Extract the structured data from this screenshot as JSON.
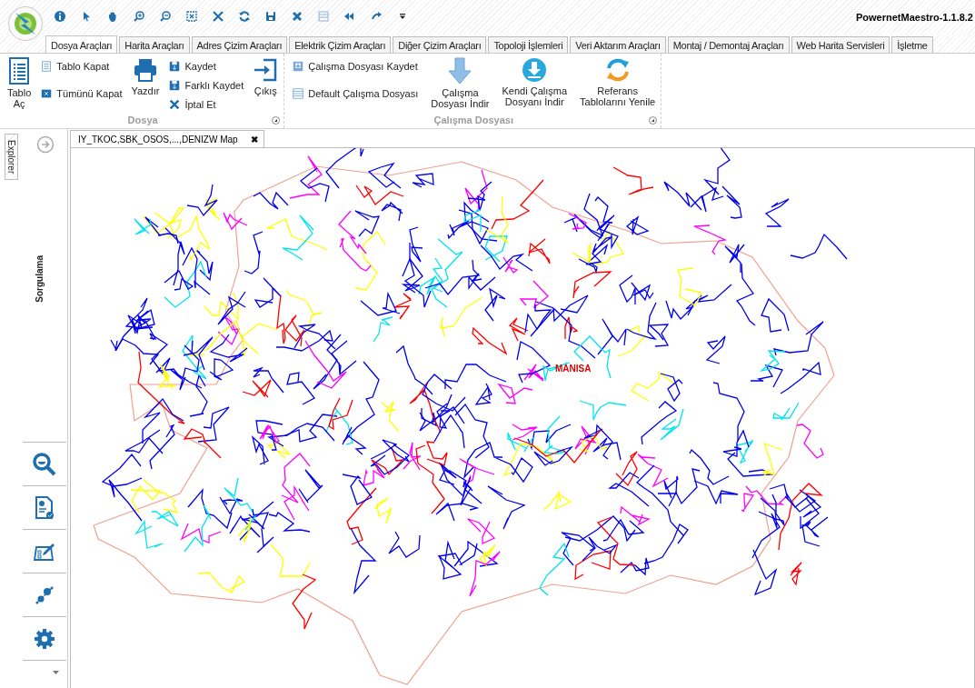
{
  "title": "PowernetMaestro-1.1.8.2",
  "tabs": [
    {
      "label": "Dosya Araçları",
      "selected": true
    },
    {
      "label": "Harita Araçları",
      "selected": false
    },
    {
      "label": "Adres Çizim Araçları",
      "selected": false
    },
    {
      "label": "Elektrik Çizim Araçları",
      "selected": false
    },
    {
      "label": "Diğer Çizim Araçları",
      "selected": false
    },
    {
      "label": "Topoloji İşlemleri",
      "selected": false
    },
    {
      "label": "Veri Aktarım Araçları",
      "selected": false
    },
    {
      "label": "Montaj / Demontaj Araçları",
      "selected": false
    },
    {
      "label": "Web Harita Servisleri",
      "selected": false
    },
    {
      "label": "İşletme",
      "selected": false
    }
  ],
  "ribbon_groups": [
    {
      "title": "Dosya",
      "columns": [
        {
          "kind": "large",
          "label": "Tablo\nAç"
        },
        {
          "kind": "stack",
          "items": [
            "Tablo Kapat",
            "Tümünü Kapat"
          ]
        },
        {
          "kind": "large",
          "label": "Yazdır"
        },
        {
          "kind": "stack",
          "items": [
            "Kaydet",
            "Farklı Kaydet",
            "İptal Et"
          ]
        },
        {
          "kind": "large",
          "label": "Çıkış"
        }
      ]
    },
    {
      "title": "Çalışma Dosyası",
      "columns": [
        {
          "kind": "stack",
          "items": [
            "Çalışma Dosyası Kaydet",
            "Default Çalışma Dosyası"
          ]
        },
        {
          "kind": "large",
          "label": "Çalışma\nDosyası İndir"
        },
        {
          "kind": "large",
          "label": "Kendi Çalışma\nDosyanı İndir"
        },
        {
          "kind": "large",
          "label": "Referans\nTablolarını Yenile"
        }
      ]
    }
  ],
  "side_panel": {
    "explorer_tab": "Explorer",
    "section_title": "Sorgulama"
  },
  "document_tab": {
    "label": "IY_TKOC,SBK_OSOS,...,DENIZW Map",
    "close": "✖"
  },
  "map": {
    "place_label": "MANISA"
  }
}
